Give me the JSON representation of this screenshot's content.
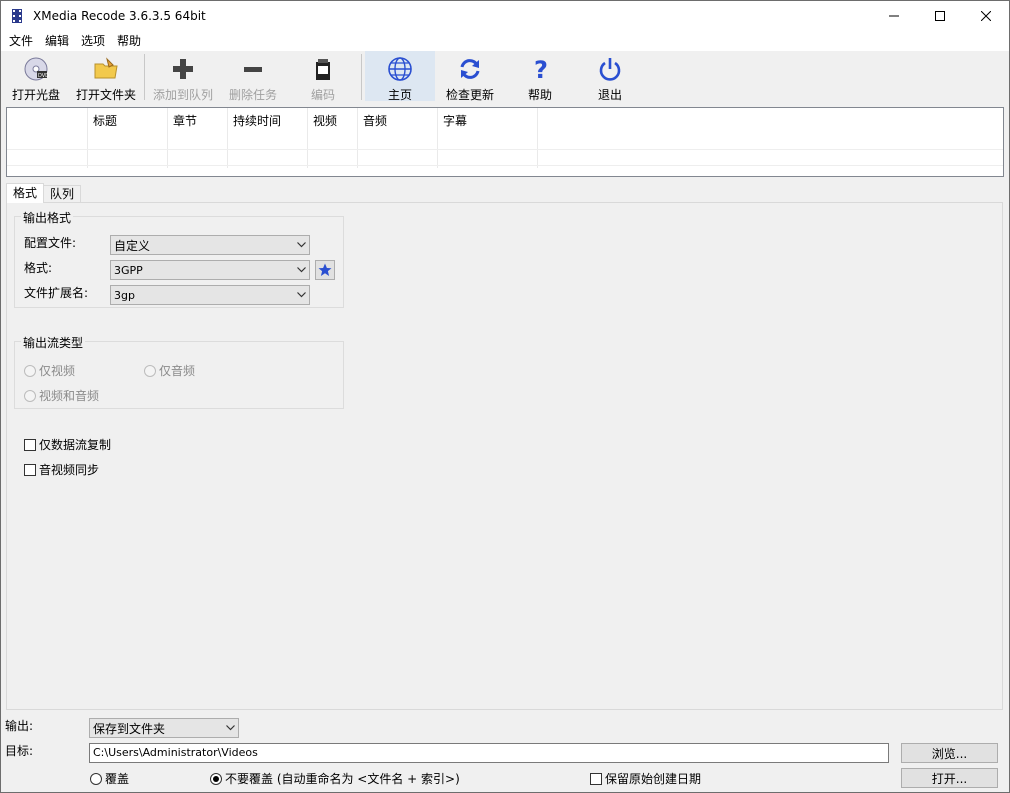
{
  "window": {
    "title": "XMedia Recode 3.6.3.5 64bit"
  },
  "menu": [
    "文件",
    "编辑",
    "选项",
    "帮助"
  ],
  "toolbar": {
    "open_disc": "打开光盘",
    "open_folder": "打开文件夹",
    "add_queue": "添加到队列",
    "delete_task": "删除任务",
    "encode": "编码",
    "home": "主页",
    "check_update": "检查更新",
    "help": "帮助",
    "exit": "退出"
  },
  "filelist": {
    "columns": [
      "",
      "标题",
      "章节",
      "持续时间",
      "视频",
      "音频",
      "字幕"
    ]
  },
  "tabs": [
    "格式",
    "队列"
  ],
  "output_format": {
    "group_title": "输出格式",
    "profile_label": "配置文件:",
    "profile_value": "自定义",
    "format_label": "格式:",
    "format_value": "3GPP",
    "extension_label": "文件扩展名:",
    "extension_value": "3gp"
  },
  "stream_type": {
    "group_title": "输出流类型",
    "video_only": "仅视频",
    "audio_only": "仅音频",
    "video_audio": "视频和音频"
  },
  "options": {
    "stream_copy": "仅数据流复制",
    "av_sync": "音视频同步"
  },
  "bottom": {
    "output_label": "输出:",
    "output_value": "保存到文件夹",
    "target_label": "目标:",
    "target_path": "C:\\Users\\Administrator\\Videos",
    "browse": "浏览...",
    "overwrite": "覆盖",
    "no_overwrite": "不要覆盖 (自动重命名为 <文件名 + 索引>)",
    "keep_date": "保留原始创建日期",
    "open": "打开..."
  },
  "colors": {
    "accent_blue": "#2a4fd1",
    "disabled_text": "#a0a0a0"
  }
}
